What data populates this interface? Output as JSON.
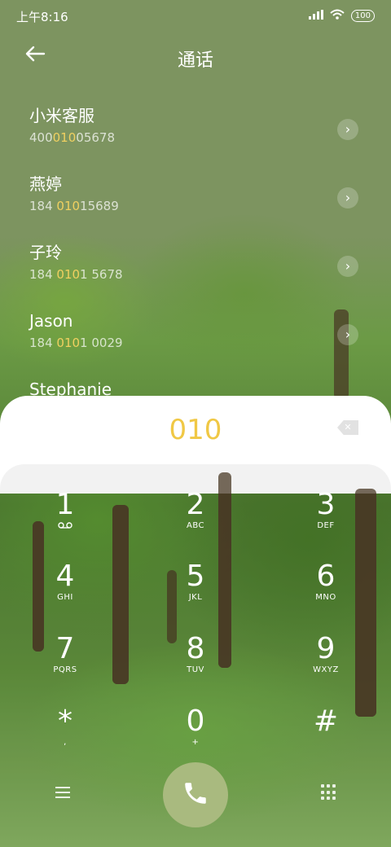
{
  "status_bar": {
    "time": "上午8:16",
    "battery": "100"
  },
  "header": {
    "title": "通话"
  },
  "contacts": [
    {
      "name": "小米客服",
      "number_pre": "400",
      "number_match": "010",
      "number_post": "05678"
    },
    {
      "name": "燕婷",
      "number_pre": "184 ",
      "number_match": "010",
      "number_post": "15689"
    },
    {
      "name": "子玲",
      "number_pre": "184 ",
      "number_match": "010",
      "number_post": "1 5678"
    },
    {
      "name": "Jason",
      "number_pre": "184 ",
      "number_match": "010",
      "number_post": "1 0029"
    },
    {
      "name": "Stephanie",
      "number_pre": "",
      "number_match": "",
      "number_post": ""
    }
  ],
  "dialer": {
    "dialed": "010",
    "keys": [
      {
        "digit": "1",
        "letters": ""
      },
      {
        "digit": "2",
        "letters": "ABC"
      },
      {
        "digit": "3",
        "letters": "DEF"
      },
      {
        "digit": "4",
        "letters": "GHI"
      },
      {
        "digit": "5",
        "letters": "JKL"
      },
      {
        "digit": "6",
        "letters": "MNO"
      },
      {
        "digit": "7",
        "letters": "PQRS"
      },
      {
        "digit": "8",
        "letters": "TUV"
      },
      {
        "digit": "9",
        "letters": "WXYZ"
      },
      {
        "digit": "*",
        "letters": ","
      },
      {
        "digit": "0",
        "letters": "+"
      },
      {
        "digit": "#",
        "letters": ""
      }
    ]
  },
  "icons": {
    "back": "arrow-left-icon",
    "chevron": "chevron-right-icon",
    "delete": "backspace-icon",
    "voicemail": "voicemail-icon",
    "menu": "menu-icon",
    "call": "phone-icon",
    "keypad": "keypad-icon"
  },
  "colors": {
    "accent": "#f0c845",
    "call_button": "#a9ba7f",
    "header_bg": "#7d9460"
  }
}
